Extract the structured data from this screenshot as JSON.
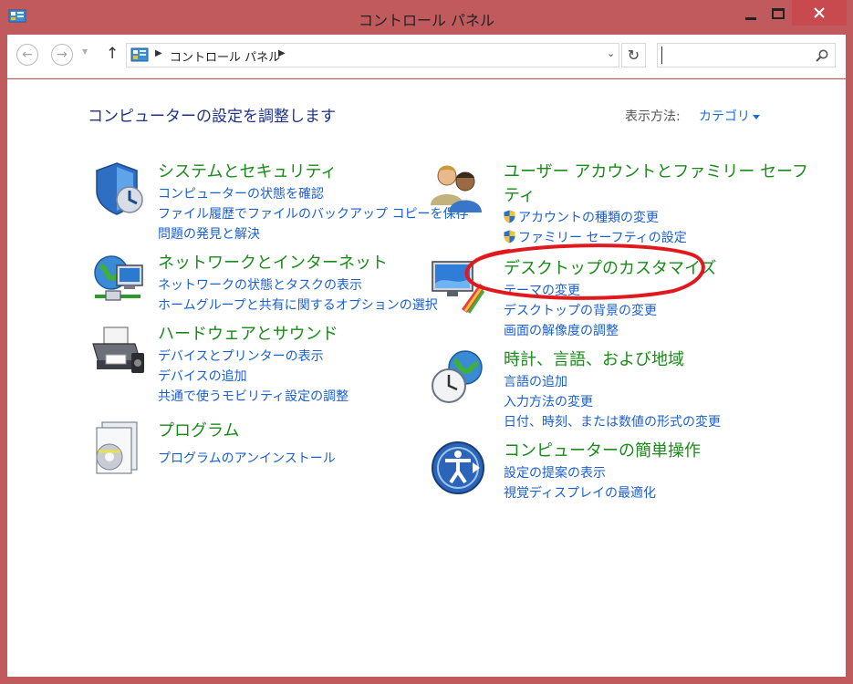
{
  "window": {
    "title": "コントロール パネル"
  },
  "navbar": {
    "address_text": "コントロール パネル",
    "search_placeholder": ""
  },
  "content": {
    "page_title": "コンピューターの設定を調整します",
    "view_by_label": "表示方法:",
    "view_by_value": "カテゴリ"
  },
  "categories": {
    "system": {
      "title": "システムとセキュリティ",
      "links": [
        "コンピューターの状態を確認",
        "ファイル履歴でファイルのバックアップ コピーを保存",
        "問題の発見と解決"
      ]
    },
    "network": {
      "title": "ネットワークとインターネット",
      "links": [
        "ネットワークの状態とタスクの表示",
        "ホームグループと共有に関するオプションの選択"
      ]
    },
    "hardware": {
      "title": "ハードウェアとサウンド",
      "links": [
        "デバイスとプリンターの表示",
        "デバイスの追加",
        "共通で使うモビリティ設定の調整"
      ]
    },
    "programs": {
      "title": "プログラム",
      "links": [
        "プログラムのアンインストール"
      ]
    },
    "users": {
      "title_line1": "ユーザー アカウントとファミリー セーフ",
      "title_line2": "ティ",
      "links": [
        "アカウントの種類の変更",
        "ファミリー セーフティの設定"
      ]
    },
    "appearance": {
      "title": "デスクトップのカスタマイズ",
      "links": [
        "テーマの変更",
        "デスクトップの背景の変更",
        "画面の解像度の調整"
      ]
    },
    "clock": {
      "title": "時計、言語、および地域",
      "links": [
        "言語の追加",
        "入力方法の変更",
        "日付、時刻、または数値の形式の変更"
      ]
    },
    "ease": {
      "title": "コンピューターの簡単操作",
      "links": [
        "設定の提案の表示",
        "視覚ディスプレイの最適化"
      ]
    }
  },
  "colors": {
    "frame": "#c15a5d",
    "category_title": "#1a8a1a",
    "link": "#1a5fcf",
    "page_title": "#1e3287",
    "annotation": "#e0191e"
  }
}
